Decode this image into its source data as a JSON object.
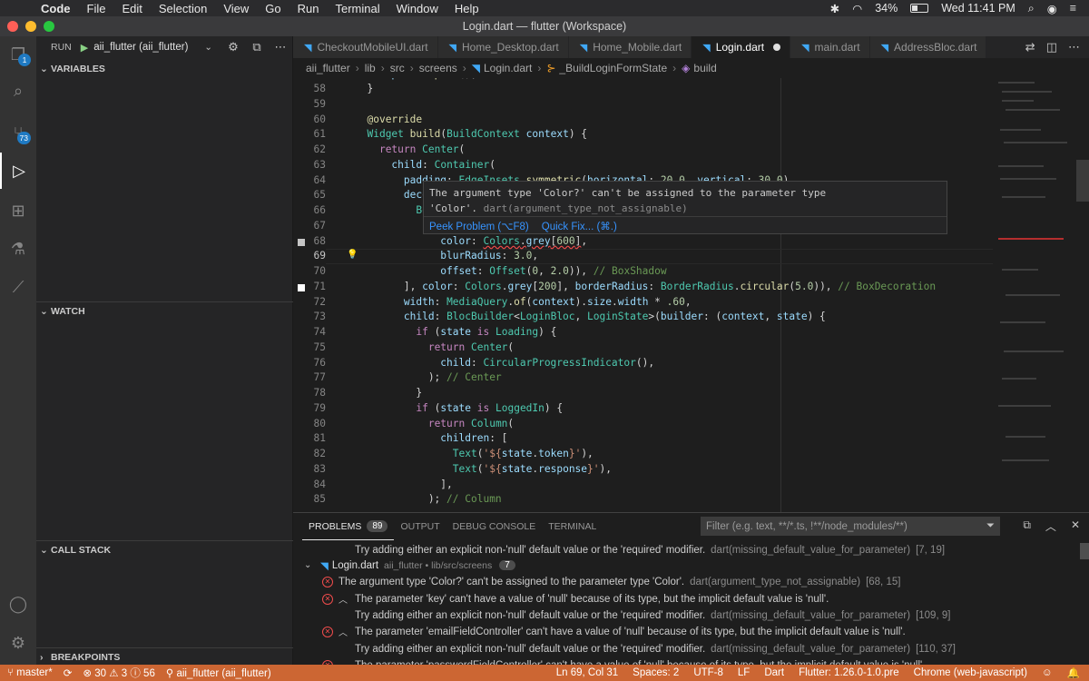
{
  "menubar": {
    "app": "Code",
    "items": [
      "File",
      "Edit",
      "Selection",
      "View",
      "Go",
      "Run",
      "Terminal",
      "Window",
      "Help"
    ],
    "battery": "34%",
    "clock": "Wed 11:41 PM"
  },
  "window": {
    "title": "Login.dart — flutter (Workspace)"
  },
  "activity": {
    "explorer_badge": "1",
    "scm_badge": "73"
  },
  "sidebar": {
    "run_label": "RUN",
    "run_config": "aii_flutter (aii_flutter)",
    "sections": {
      "variables": "VARIABLES",
      "watch": "WATCH",
      "call_stack": "CALL STACK",
      "breakpoints": "BREAKPOINTS"
    }
  },
  "tabs": [
    "CheckoutMobileUI.dart",
    "Home_Desktop.dart",
    "Home_Mobile.dart",
    "Login.dart",
    "main.dart",
    "AddressBloc.dart"
  ],
  "active_tab": "Login.dart",
  "breadcrumb": [
    "aii_flutter",
    "lib",
    "src",
    "screens",
    "Login.dart",
    "_BuildLoginFormState",
    "build"
  ],
  "editor": {
    "line_numbers": [
      "58",
      "59",
      "60",
      "61",
      "62",
      "63",
      "64",
      "65",
      "66",
      "67",
      "68",
      "69",
      "70",
      "71",
      "72",
      "73",
      "74",
      "75",
      "76",
      "77",
      "78",
      "79",
      "80",
      "81",
      "82",
      "83",
      "84",
      "85"
    ]
  },
  "hover": {
    "line1": "The argument type 'Color?' can't be assigned to the parameter type",
    "line2": "'Color'.",
    "source": "dart(argument_type_not_assignable)",
    "peek": "Peek Problem (⌥F8)",
    "quickfix": "Quick Fix... (⌘.)"
  },
  "panel": {
    "tabs": [
      "PROBLEMS",
      "OUTPUT",
      "DEBUG CONSOLE",
      "TERMINAL"
    ],
    "problem_count": "89",
    "filter_placeholder": "Filter (e.g. text, **/*.ts, !**/node_modules/**)",
    "rows": [
      {
        "type": "hint",
        "text": "Try adding either an explicit non-'null' default value or the 'required' modifier.",
        "code": "dart(missing_default_value_for_parameter)",
        "pos": "[7, 19]"
      },
      {
        "type": "file",
        "file": "Login.dart",
        "dir": "aii_flutter • lib/src/screens",
        "count": "7"
      },
      {
        "type": "error",
        "text": "The argument type 'Color?' can't be assigned to the parameter type 'Color'.",
        "code": "dart(argument_type_not_assignable)",
        "pos": "[68, 15]"
      },
      {
        "type": "error-exp",
        "text": "The parameter 'key' can't have a value of 'null' because of its type, but the implicit default value is 'null'.",
        "code": "",
        "pos": ""
      },
      {
        "type": "hint",
        "text": "Try adding either an explicit non-'null' default value or the 'required' modifier.",
        "code": "dart(missing_default_value_for_parameter)",
        "pos": "[109, 9]"
      },
      {
        "type": "error-exp",
        "text": "The parameter 'emailFieldController' can't have a value of 'null' because of its type, but the implicit default value is 'null'.",
        "code": "",
        "pos": ""
      },
      {
        "type": "hint",
        "text": "Try adding either an explicit non-'null' default value or the 'required' modifier.",
        "code": "dart(missing_default_value_for_parameter)",
        "pos": "[110, 37]"
      },
      {
        "type": "error-exp",
        "text": "The parameter 'passwordFieldController' can't have a value of 'null' because of its type, but the implicit default value is 'null'.",
        "code": "",
        "pos": ""
      }
    ]
  },
  "status": {
    "branch": "master*",
    "errors": "30",
    "warnings": "3",
    "infos": "56",
    "debug_target": "aii_flutter (aii_flutter)",
    "position": "Ln 69, Col 31",
    "spaces": "Spaces: 2",
    "encoding": "UTF-8",
    "eol": "LF",
    "language": "Dart",
    "flutter": "Flutter: 1.26.0-1.0.pre",
    "device": "Chrome (web-javascript)"
  },
  "colors": {
    "status_bar": "#cc6633",
    "accent": "#3794ff",
    "error": "#f14c4c"
  }
}
